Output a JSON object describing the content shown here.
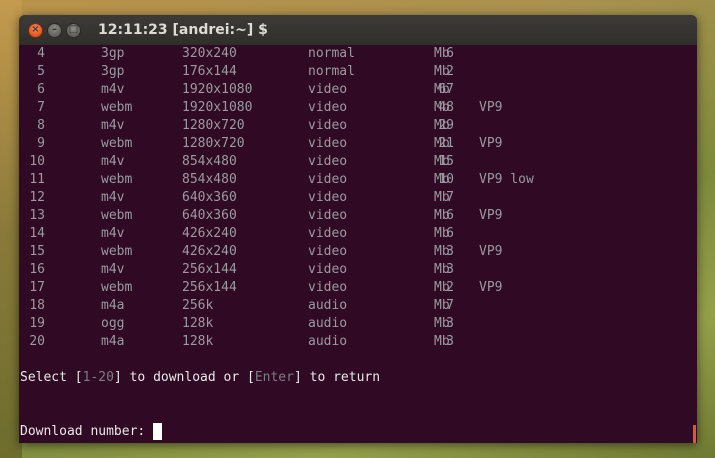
{
  "window": {
    "title": "12:11:23 [andrei:~] $",
    "close_glyph": "×",
    "minimize_glyph": "–",
    "maximize_glyph": "□"
  },
  "formats": [
    {
      "num": "4",
      "ext": "3gp",
      "res": "320x240",
      "type": "normal",
      "size": "6",
      "unit": "Mb",
      "note": ""
    },
    {
      "num": "5",
      "ext": "3gp",
      "res": "176x144",
      "type": "normal",
      "size": "2",
      "unit": "Mb",
      "note": ""
    },
    {
      "num": "6",
      "ext": "m4v",
      "res": "1920x1080",
      "type": "video",
      "size": "67",
      "unit": "Mb",
      "note": ""
    },
    {
      "num": "7",
      "ext": "webm",
      "res": "1920x1080",
      "type": "video",
      "size": "48",
      "unit": "Mb",
      "note": "VP9"
    },
    {
      "num": "8",
      "ext": "m4v",
      "res": "1280x720",
      "type": "video",
      "size": "29",
      "unit": "Mb",
      "note": ""
    },
    {
      "num": "9",
      "ext": "webm",
      "res": "1280x720",
      "type": "video",
      "size": "21",
      "unit": "Mb",
      "note": "VP9"
    },
    {
      "num": "10",
      "ext": "m4v",
      "res": "854x480",
      "type": "video",
      "size": "15",
      "unit": "Mb",
      "note": ""
    },
    {
      "num": "11",
      "ext": "webm",
      "res": "854x480",
      "type": "video",
      "size": "10",
      "unit": "Mb",
      "note": "VP9 low"
    },
    {
      "num": "12",
      "ext": "m4v",
      "res": "640x360",
      "type": "video",
      "size": "7",
      "unit": "Mb",
      "note": ""
    },
    {
      "num": "13",
      "ext": "webm",
      "res": "640x360",
      "type": "video",
      "size": "6",
      "unit": "Mb",
      "note": "VP9"
    },
    {
      "num": "14",
      "ext": "m4v",
      "res": "426x240",
      "type": "video",
      "size": "6",
      "unit": "Mb",
      "note": ""
    },
    {
      "num": "15",
      "ext": "webm",
      "res": "426x240",
      "type": "video",
      "size": "3",
      "unit": "Mb",
      "note": "VP9"
    },
    {
      "num": "16",
      "ext": "m4v",
      "res": "256x144",
      "type": "video",
      "size": "3",
      "unit": "Mb",
      "note": ""
    },
    {
      "num": "17",
      "ext": "webm",
      "res": "256x144",
      "type": "video",
      "size": "2",
      "unit": "Mb",
      "note": "VP9"
    },
    {
      "num": "18",
      "ext": "m4a",
      "res": "256k",
      "type": "audio",
      "size": "7",
      "unit": "Mb",
      "note": ""
    },
    {
      "num": "19",
      "ext": "ogg",
      "res": "128k",
      "type": "audio",
      "size": "3",
      "unit": "Mb",
      "note": ""
    },
    {
      "num": "20",
      "ext": "m4a",
      "res": "128k",
      "type": "audio",
      "size": "3",
      "unit": "Mb",
      "note": ""
    }
  ],
  "select_prompt": {
    "prefix": "Select [",
    "range": "1-20",
    "middle": "] to download or [",
    "key": "Enter",
    "suffix": "] to return"
  },
  "download_prompt": "Download number: "
}
